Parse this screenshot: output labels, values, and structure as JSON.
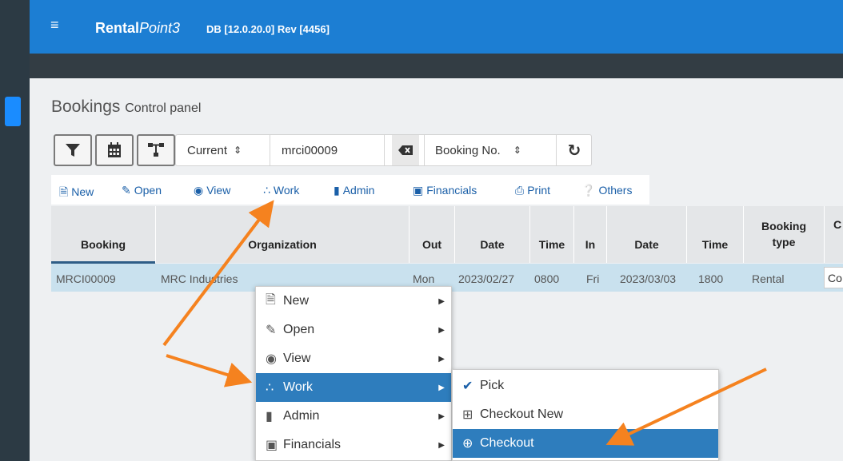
{
  "app": {
    "brand_main": "Rental",
    "brand_italic": "Point3",
    "db_info": "DB [12.0.20.0]  Rev [4456]"
  },
  "page": {
    "title": "Bookings",
    "subtitle": "Control panel"
  },
  "toolbar": {
    "filter_select": "Current",
    "search_value": "mrci00009",
    "search_field_select": "Booking No."
  },
  "actions": [
    {
      "label": "New",
      "icon": "file-icon"
    },
    {
      "label": "Open",
      "icon": "edit-icon"
    },
    {
      "label": "View",
      "icon": "eye-icon"
    },
    {
      "label": "Work",
      "icon": "spinner-icon"
    },
    {
      "label": "Admin",
      "icon": "folder-icon"
    },
    {
      "label": "Financials",
      "icon": "money-icon"
    },
    {
      "label": "Print",
      "icon": "print-icon"
    },
    {
      "label": "Others",
      "icon": "question-icon"
    }
  ],
  "table": {
    "headers": {
      "booking": "Booking",
      "organization": "Organization",
      "out": "Out",
      "out_date": "Date",
      "out_time": "Time",
      "in": "In",
      "in_date": "Date",
      "in_time": "Time",
      "booking_type_1": "Booking",
      "booking_type_2": "type",
      "last": "C"
    },
    "rows": [
      {
        "booking": "MRCI00009",
        "organization": "MRC Industries",
        "out": "Mon",
        "out_date": "2023/02/27",
        "out_time": "0800",
        "in": "Fri",
        "in_date": "2023/03/03",
        "in_time": "1800",
        "booking_type": "Rental",
        "last": "Co"
      }
    ]
  },
  "context_menu": {
    "items": [
      {
        "label": "New",
        "icon": "file-icon"
      },
      {
        "label": "Open",
        "icon": "edit-icon"
      },
      {
        "label": "View",
        "icon": "eye-icon"
      },
      {
        "label": "Work",
        "icon": "spinner-icon",
        "active": true
      },
      {
        "label": "Admin",
        "icon": "folder-icon"
      },
      {
        "label": "Financials",
        "icon": "money-icon"
      }
    ],
    "submenu": [
      {
        "label": "Pick",
        "icon": "check-icon"
      },
      {
        "label": "Checkout New",
        "icon": "plus-square-icon"
      },
      {
        "label": "Checkout",
        "icon": "plus-circle-icon",
        "active": true
      }
    ]
  },
  "colors": {
    "topbar": "#1c7ed3",
    "menu_active": "#2e7dbd",
    "annotation_arrow": "#f5821f",
    "row_selected": "#c9e1ee"
  }
}
